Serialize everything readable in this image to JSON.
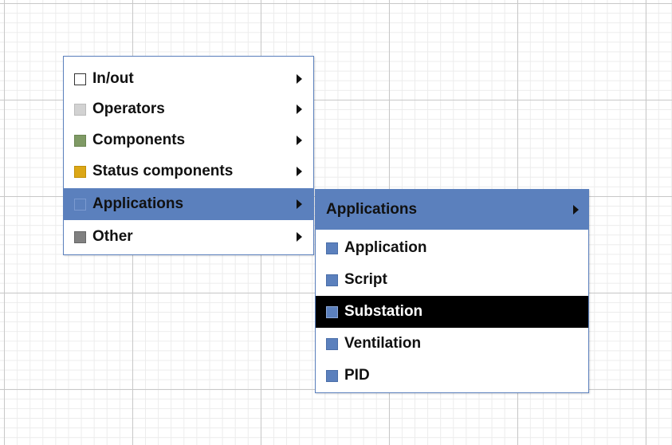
{
  "main_menu": {
    "items": [
      {
        "label": "In/out",
        "icon": "white-square-icon",
        "color": "#ffffff"
      },
      {
        "label": "Operators",
        "icon": "light-gray-square-icon",
        "color": "#d2d2d2"
      },
      {
        "label": "Components",
        "icon": "green-square-icon",
        "color": "#7f9a65"
      },
      {
        "label": "Status components",
        "icon": "yellow-square-icon",
        "color": "#dca716"
      },
      {
        "label": "Applications",
        "icon": "blue-square-icon",
        "color": "#5b80bd",
        "highlighted": true
      },
      {
        "label": "Other",
        "icon": "gray-square-icon",
        "color": "#808080"
      }
    ]
  },
  "sub_menu": {
    "header": "Applications",
    "items": [
      {
        "label": "Application",
        "icon": "blue-square-icon"
      },
      {
        "label": "Script",
        "icon": "blue-square-icon"
      },
      {
        "label": "Substation",
        "icon": "blue-square-icon",
        "selected": true
      },
      {
        "label": "Ventilation",
        "icon": "blue-square-icon"
      },
      {
        "label": "PID",
        "icon": "blue-square-icon"
      }
    ]
  },
  "colors": {
    "accent": "#5b80bd",
    "selected_background": "#000000",
    "selected_text": "#ffffff",
    "grid_major": "#c8c8c8",
    "grid_minor": "#ececec"
  }
}
